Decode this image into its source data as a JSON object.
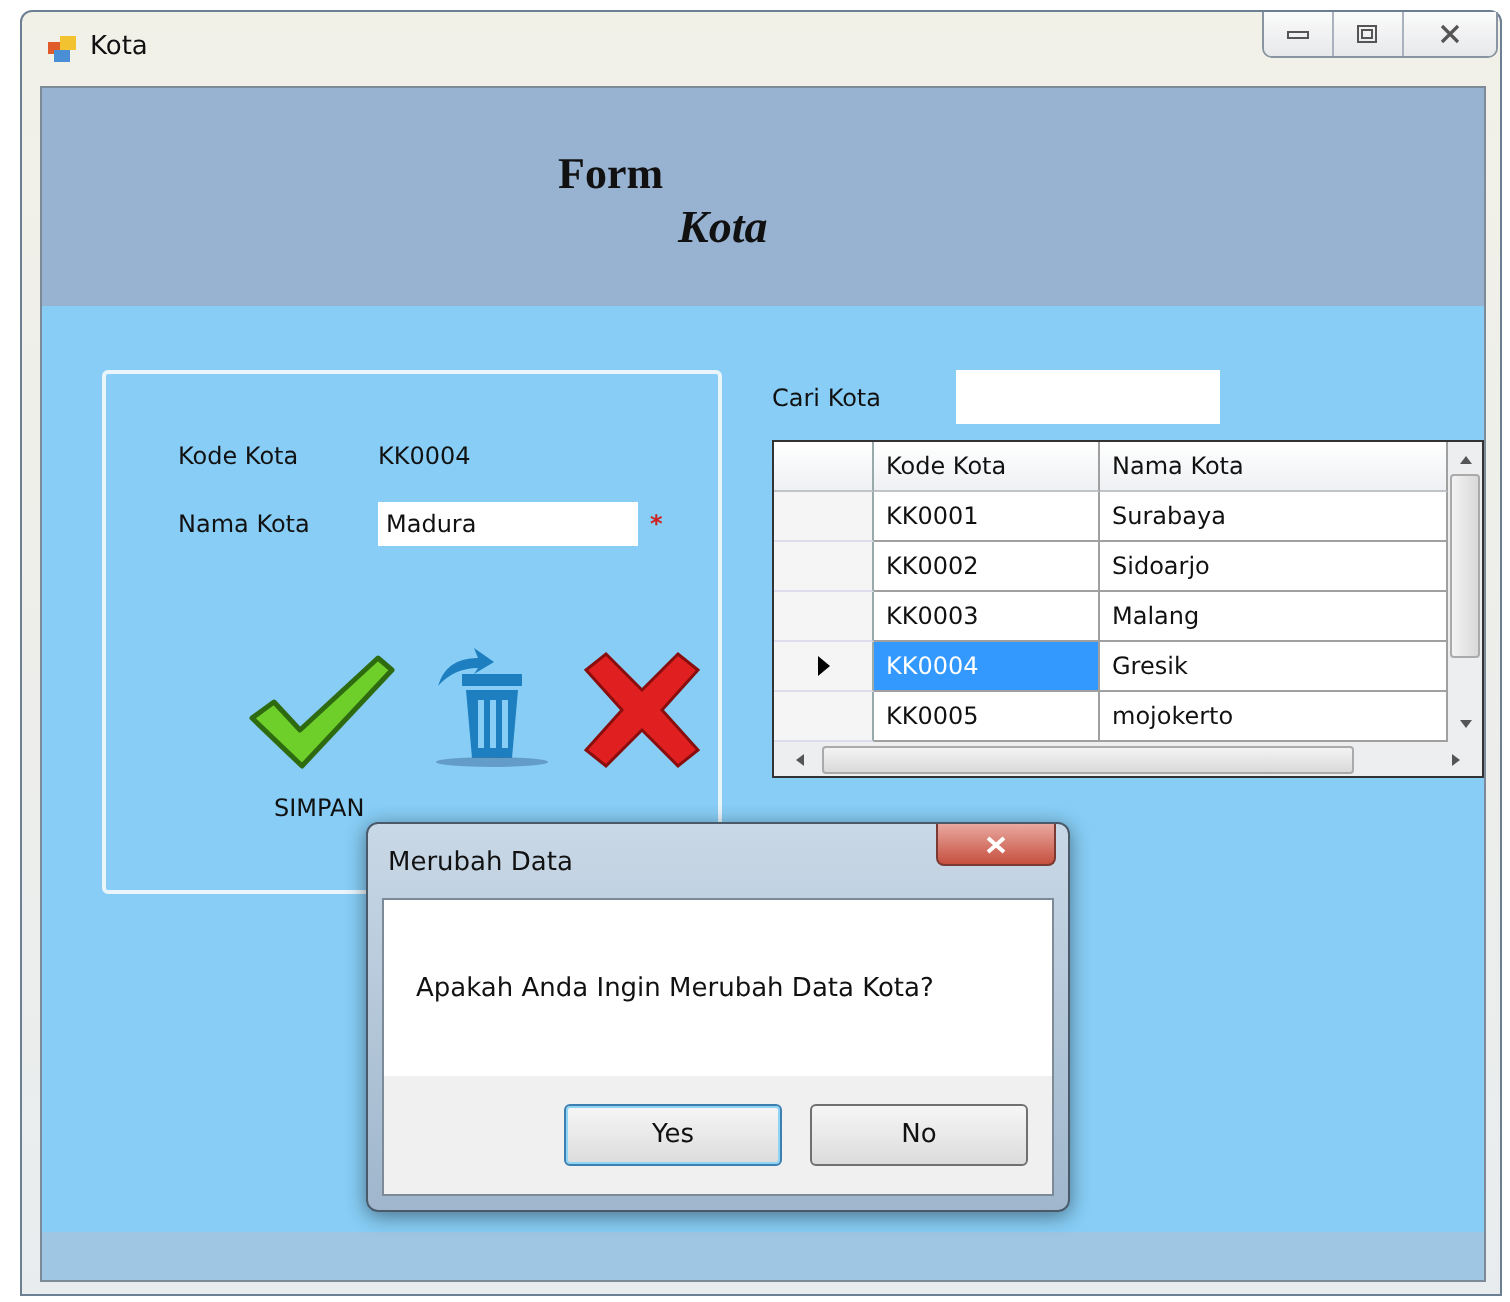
{
  "window": {
    "title": "Kota"
  },
  "header": {
    "line_1": "Form",
    "line_2": "Kota"
  },
  "form": {
    "kode_label": "Kode Kota",
    "kode_value": "KK0004",
    "nama_label": "Nama Kota",
    "nama_value": "Madura",
    "required_mark": "*",
    "save_label": "SIMPAN"
  },
  "search": {
    "label": "Cari Kota"
  },
  "table": {
    "columns": [
      "Kode Kota",
      "Nama Kota"
    ],
    "rows": [
      {
        "cells": [
          "KK0001",
          "Surabaya"
        ],
        "selected": false
      },
      {
        "cells": [
          "KK0002",
          "Sidoarjo"
        ],
        "selected": false
      },
      {
        "cells": [
          "KK0003",
          "Malang"
        ],
        "selected": false
      },
      {
        "cells": [
          "KK0004",
          "Gresik"
        ],
        "selected": true
      },
      {
        "cells": [
          "KK0005",
          "mojokerto"
        ],
        "selected": false
      }
    ]
  },
  "dialog": {
    "title": "Merubah Data",
    "message": "Apakah Anda Ingin Merubah Data Kota?",
    "buttons": [
      {
        "label": "Yes",
        "selected": true
      },
      {
        "label": "No",
        "selected": false
      }
    ]
  }
}
